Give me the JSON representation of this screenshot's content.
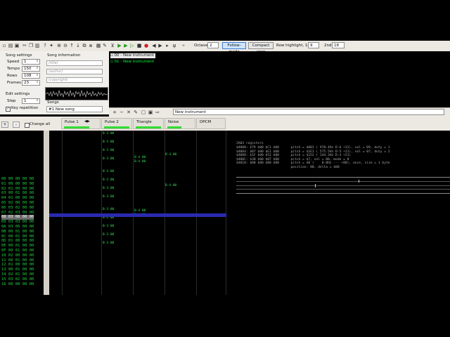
{
  "toolbar": {
    "octave_label": "Octave",
    "octave_value": "2",
    "follow_mode": "Follow-mode",
    "compact_view": "Compact view",
    "row_highlight_label": "Row highlight, 1st",
    "row_highlight_1st": "9",
    "row_highlight_2nd_label": "2nd",
    "row_highlight_2nd": "18"
  },
  "song_settings": {
    "title": "Song settings",
    "speed_label": "Speed",
    "speed_value": "1",
    "tempo_label": "Tempo",
    "tempo_value": "150",
    "rows_label": "Rows",
    "rows_value": "108",
    "frames_label": "Frames",
    "frames_value": "23"
  },
  "edit_settings": {
    "title": "Edit settings",
    "step_label": "Step",
    "step_value": "1",
    "key_repetition": "Key repetition"
  },
  "song_info": {
    "title": "Song information",
    "title_placeholder": "(title)",
    "author_placeholder": "(author)",
    "copyright_placeholder": "(copyright)"
  },
  "songs": {
    "title": "Songs",
    "selected": "#1 New song"
  },
  "instruments": [
    {
      "label": "00 - New instrument"
    },
    {
      "label": "01 - New instrument"
    }
  ],
  "instrument_name": "New instrument",
  "frames_panel": {
    "plus": "+",
    "minus": "-",
    "change_all": "Change all",
    "rows": [
      "00 00 00 00 00",
      "01 00 00 00 00",
      "02 01 00 00 00",
      "03 00 01 00 00",
      "04 01 00 00 00",
      "05 02 00 00 00",
      "06 03 02 00 00",
      "07 02 03 00 00",
      "08 03 00 00 00",
      "09 03 03 00 00",
      "0A 03 00 00 00",
      "0B 00 01 00 00",
      "0C 00 01 00 00",
      "0D 01 00 00 00",
      "0E 00 01 00 00",
      "0F 00 01 00 00",
      "10 02 00 00 00",
      "11 00 01 00 00",
      "12 01 00 00 00",
      "13 00 01 00 00",
      "14 02 01 00 00",
      "15 03 02 00 00",
      "16 00 00 00 00"
    ]
  },
  "channels": [
    {
      "name": "Pulse 1"
    },
    {
      "name": "Pulse 2"
    },
    {
      "name": "Triangle"
    },
    {
      "name": "Noise"
    },
    {
      "name": "DPCM"
    }
  ],
  "registers": {
    "title": "2A03 registers",
    "lines": [
      "$4000: $79 $00 $C1 $00      pitch = $001 ( 970.4Hz D-6 +31), vol = 09, duty = 1",
      "$4004: $B7 $00 $E1 $00      pitch = $1E1 ( 575.5Hz D-5 +21), vol = 07, duty = 2",
      "$4008: $1F $00 $52 $00      pitch = $152 ( 144.3Hz D-3 +21)",
      "$400C: $30 $00 $07 $00      pitch = $7, vol = 00, mode = 0",
      "$4010: $00 $00 $00 $00      pitch = $0 (    0.0Hz --- +00), once, size = 1 byte",
      "                            position: 00, delta = $00"
    ]
  }
}
